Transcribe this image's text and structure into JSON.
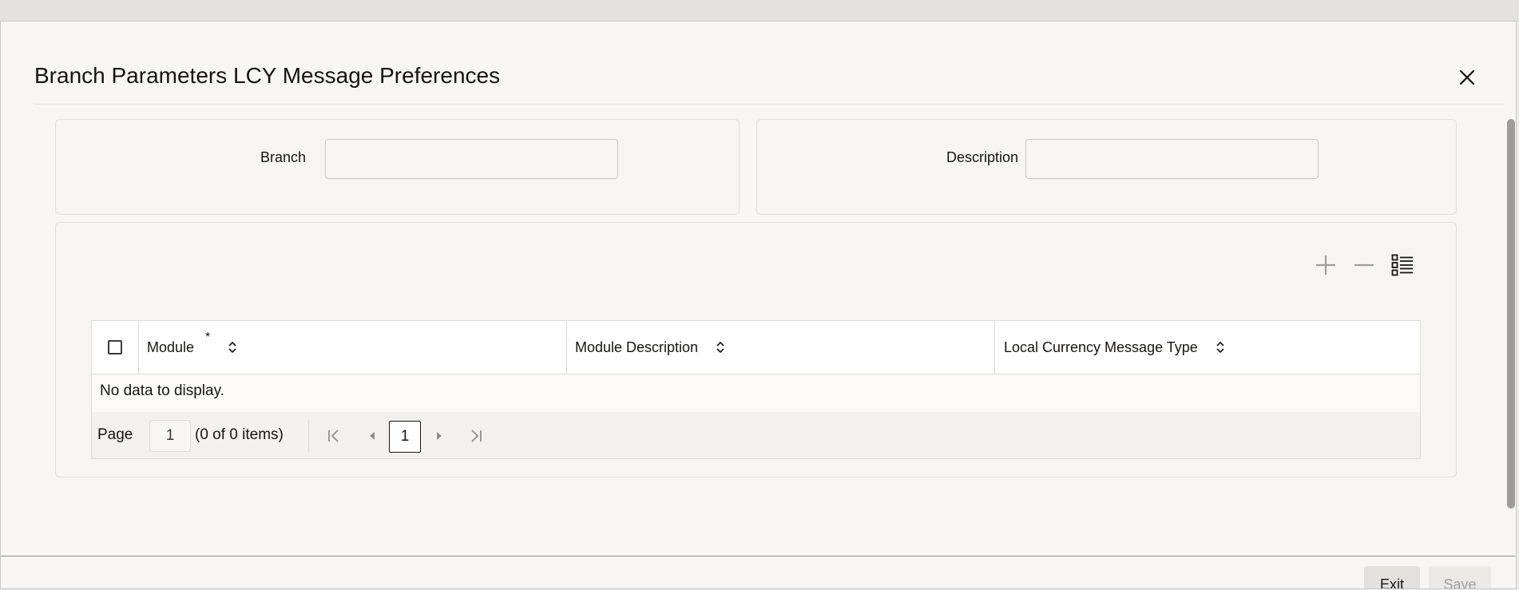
{
  "dialog": {
    "title": "Branch Parameters LCY Message Preferences"
  },
  "header_form": {
    "branch_label": "Branch",
    "branch_value": "",
    "description_label": "Description",
    "description_value": ""
  },
  "table": {
    "columns": [
      {
        "label": "Module",
        "required": true,
        "required_mark": "*"
      },
      {
        "label": "Module Description",
        "required": false
      },
      {
        "label": "Local Currency Message Type",
        "required": false
      }
    ],
    "rows": [],
    "empty_message": "No data to display."
  },
  "pagination": {
    "page_label": "Page",
    "page_input_value": "1",
    "items_summary": "(0 of 0 items)",
    "current_page": "1"
  },
  "toolbar": {
    "icons": [
      "add-icon",
      "remove-icon",
      "list-view-icon"
    ]
  },
  "footer": {
    "exit_label": "Exit",
    "save_label": "Save"
  },
  "colors": {
    "panel_background": "#f6f5f3",
    "text": "#161513",
    "border": "#dcdbd8",
    "disabled_icon": "#9e9d9b"
  }
}
